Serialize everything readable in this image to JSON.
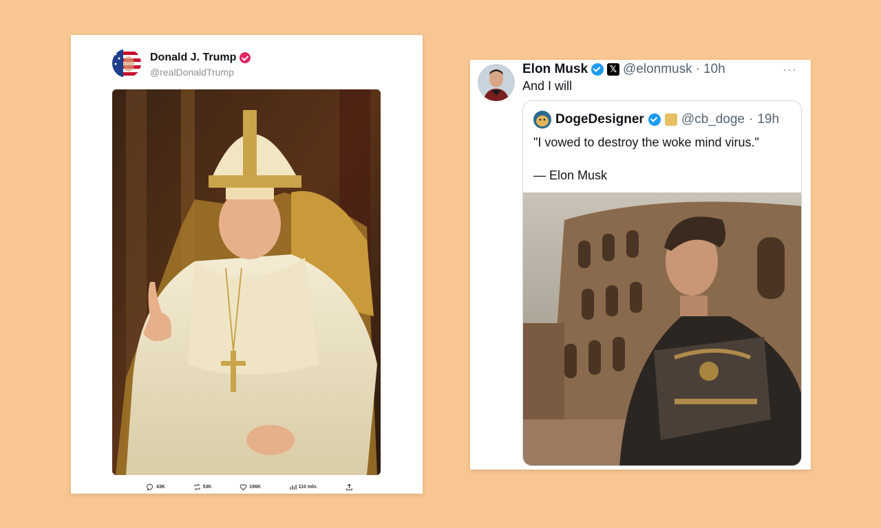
{
  "post_left": {
    "author_name": "Donald J. Trump",
    "handle": "@realDonaldTrump",
    "image_alt_icon": "pope-portrait-image",
    "actions": {
      "replies": "43K",
      "reposts": "53K",
      "likes": "196K",
      "views": "110 mln."
    },
    "colors": {
      "verified": "#e0245e"
    }
  },
  "post_right": {
    "author_name": "Elon Musk",
    "handle": "@elonmusk",
    "separator": "·",
    "time": "10h",
    "more": "···",
    "x_badge": "𝕏",
    "text": "And I will",
    "quote": {
      "author_name": "DogeDesigner",
      "handle": "@cb_doge",
      "separator": "·",
      "time": "19h",
      "text": "\"I vowed to destroy the woke mind virus.\"",
      "attribution": "— Elon Musk",
      "image_alt_icon": "gladiator-colosseum-image"
    },
    "colors": {
      "verified": "#1d9bf0"
    }
  },
  "background_color": "#f8c690"
}
